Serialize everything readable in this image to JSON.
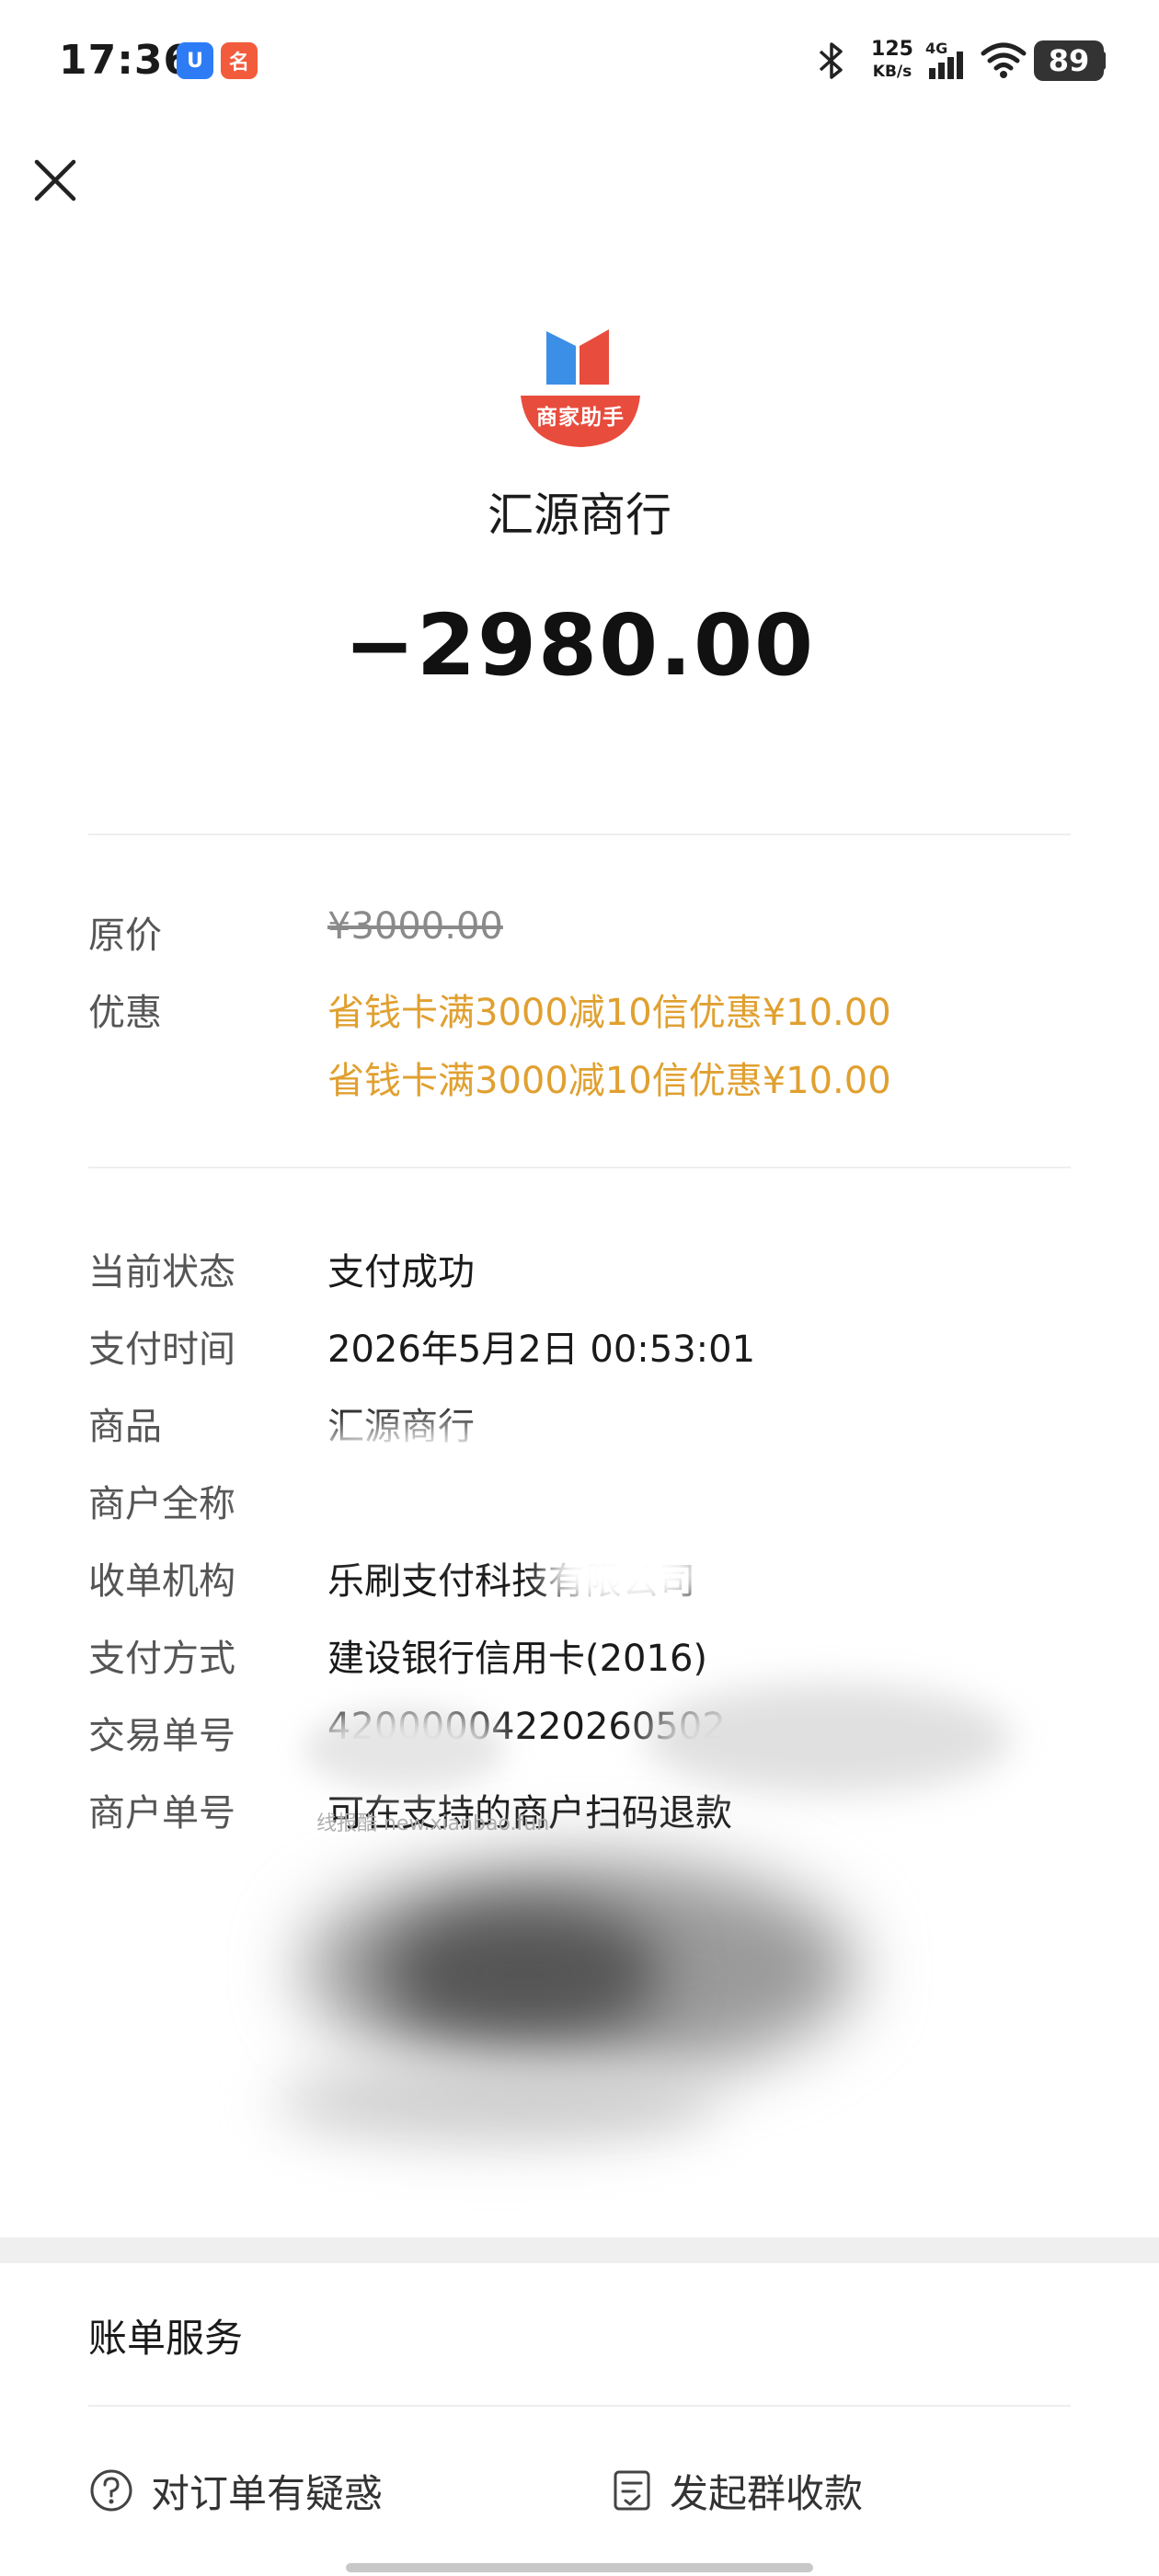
{
  "status_bar": {
    "time": "17:36",
    "app_badges": [
      "U",
      "名"
    ],
    "net_speed_value": "125",
    "net_speed_unit": "KB/s",
    "network": "4G",
    "battery": "89"
  },
  "merchant": {
    "logo_text": "商家助手",
    "name": "汇源商行",
    "amount": "−2980.00"
  },
  "price": {
    "original_label": "原价",
    "original_value": "¥3000.00",
    "discount_label": "优惠",
    "discounts": [
      "省钱卡满3000减10信优惠¥10.00",
      "省钱卡满3000减10信优惠¥10.00"
    ]
  },
  "details": [
    {
      "label": "当前状态",
      "value": "支付成功"
    },
    {
      "label": "支付时间",
      "value": "2026年5月2日 00:53:01"
    },
    {
      "label": "商品",
      "value": "汇源商行"
    },
    {
      "label": "商户全称",
      "value": ""
    },
    {
      "label": "收单机构",
      "value": "乐刷支付科技有限公司"
    },
    {
      "label": "支付方式",
      "value": "建设银行信用卡(2016)"
    },
    {
      "label": "交易单号",
      "value": "42000004220260502"
    },
    {
      "label": "商户单号",
      "value": "可在支持的商户扫码退款"
    }
  ],
  "watermark_note": "线报酷 new.xianbao.fun",
  "bill_service": {
    "title": "账单服务",
    "actions": [
      {
        "label": "对订单有疑惑",
        "icon": "question-circle-icon"
      },
      {
        "label": "发起群收款",
        "icon": "group-collect-icon"
      }
    ]
  },
  "colors": {
    "promo": "#e0a030",
    "logo_red": "#e84c3d",
    "logo_blue": "#3b8fe6"
  }
}
